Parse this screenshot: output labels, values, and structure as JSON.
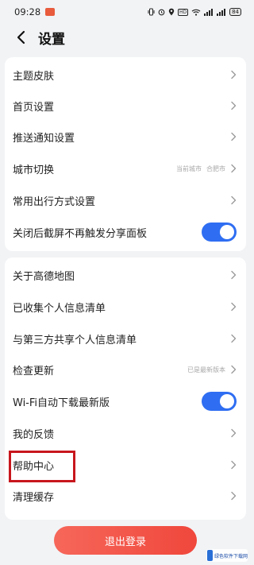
{
  "status_bar": {
    "time": "09:28",
    "battery": "84"
  },
  "header": {
    "title": "设置",
    "back_icon": "chevron-left-icon"
  },
  "settings_group_1": [
    {
      "label": "主题皮肤"
    },
    {
      "label": "首页设置"
    },
    {
      "label": "推送通知设置"
    },
    {
      "label": "城市切换",
      "value_1": "当前城市",
      "value_2": "合肥市"
    },
    {
      "label": "常用出行方式设置"
    },
    {
      "label": "关闭后截屏不再触发分享面板",
      "toggle_on": true
    }
  ],
  "settings_group_2": [
    {
      "label": "关于高德地图"
    },
    {
      "label": "已收集个人信息清单"
    },
    {
      "label": "与第三方共享个人信息清单"
    },
    {
      "label": "检查更新",
      "value_1": "已是最新版本"
    },
    {
      "label": "Wi-Fi自动下载最新版",
      "toggle_on": true
    },
    {
      "label": "我的反馈"
    },
    {
      "label": "帮助中心"
    },
    {
      "label": "清理缓存"
    }
  ],
  "logout": {
    "label": "退出登录"
  },
  "watermark": {
    "text": "绿色软件下载网"
  },
  "colors": {
    "toggle_on": "#2f6ef2",
    "logout_start": "#f6675a",
    "logout_end": "#f0473c",
    "highlight": "#c8161d",
    "background": "#f2f3f5"
  }
}
